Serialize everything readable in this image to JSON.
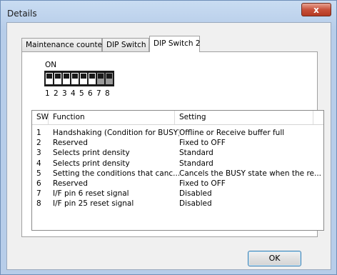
{
  "window": {
    "title": "Details"
  },
  "tabs": [
    {
      "label": "Maintenance counter"
    },
    {
      "label": "DIP Switch 1"
    },
    {
      "label": "DIP Switch 2"
    }
  ],
  "dip": {
    "on_label": "ON",
    "numbers": [
      "1",
      "2",
      "3",
      "4",
      "5",
      "6",
      "7",
      "8"
    ],
    "states": [
      "on",
      "on",
      "on",
      "on",
      "on",
      "on",
      "on",
      "on"
    ]
  },
  "table": {
    "headers": {
      "sw": "SW",
      "function": "Function",
      "setting": "Setting"
    },
    "rows": [
      {
        "sw": "1",
        "function": "Handshaking (Condition for BUSY)",
        "setting": "Offline or Receive buffer full"
      },
      {
        "sw": "2",
        "function": "Reserved",
        "setting": "Fixed to OFF"
      },
      {
        "sw": "3",
        "function": "Selects print density",
        "setting": "Standard"
      },
      {
        "sw": "4",
        "function": "Selects print density",
        "setting": "Standard"
      },
      {
        "sw": "5",
        "function": "Setting the conditions that canc...",
        "setting": "Cancels the BUSY state when the re..."
      },
      {
        "sw": "6",
        "function": "Reserved",
        "setting": "Fixed to OFF"
      },
      {
        "sw": "7",
        "function": "I/F pin 6 reset signal",
        "setting": "Disabled"
      },
      {
        "sw": "8",
        "function": "I/F pin 25 reset signal",
        "setting": "Disabled"
      }
    ]
  },
  "buttons": {
    "ok": "OK",
    "close": "x"
  }
}
